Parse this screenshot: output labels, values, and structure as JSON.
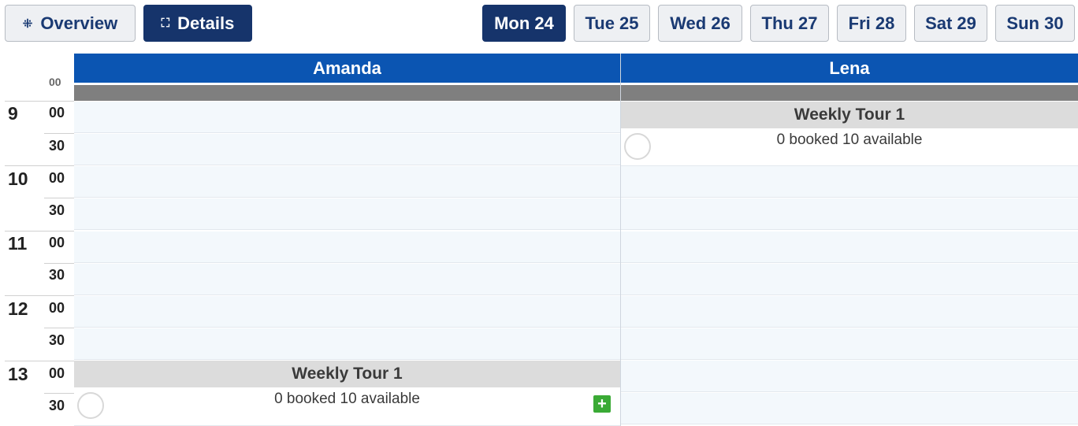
{
  "toolbar": {
    "overview_label": "Overview",
    "details_label": "Details",
    "days": [
      "Mon 24",
      "Tue 25",
      "Wed 26",
      "Thu 27",
      "Fri 28",
      "Sat 29",
      "Sun 30"
    ],
    "active_day": "Mon 24"
  },
  "columns": [
    "Amanda",
    "Lena"
  ],
  "time_axis": {
    "hours": [
      "9",
      "10",
      "11",
      "12",
      "13"
    ],
    "minutes": [
      "00",
      "30"
    ],
    "top_stub": "00"
  },
  "events": [
    {
      "column": "Lena",
      "start": "9:00",
      "title": "Weekly Tour 1",
      "status": "0 booked 10 available",
      "has_add_button": false
    },
    {
      "column": "Amanda",
      "start": "13:00",
      "title": "Weekly Tour 1",
      "status": "0 booked 10 available",
      "has_add_button": true
    }
  ],
  "add_symbol": "+",
  "colors": {
    "header_blue": "#0b55b2",
    "active_button": "#16346b",
    "cell_bg": "#f3f8fc",
    "event_header": "#dcdcdc",
    "add_green": "#3aaa35"
  }
}
